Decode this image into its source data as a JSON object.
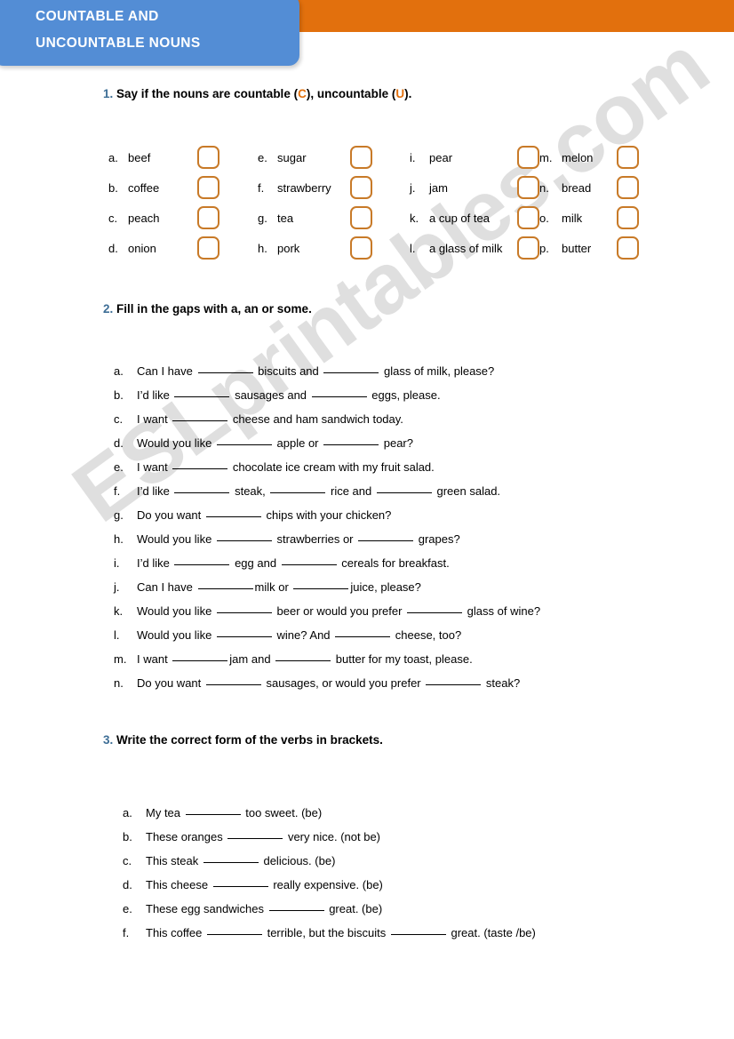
{
  "header": {
    "title_line1": "COUNTABLE AND",
    "title_line2": "UNCOUNTABLE NOUNS",
    "band_color": "#E2700D",
    "plate_color": "#538DD5"
  },
  "watermark": {
    "text": "ESLprintables.com"
  },
  "colors": {
    "heading_number": "#3E6E96",
    "accent_orange": "#E2700D",
    "checkbox_border": "#C87A28"
  },
  "exercise1": {
    "number": "1.",
    "instruction_pre": "Say if the nouns are countable (",
    "c_marker": "C",
    "instruction_mid": "), uncountable (",
    "u_marker": "U",
    "instruction_post": ").",
    "columns": [
      [
        {
          "letter": "a.",
          "word": "beef"
        },
        {
          "letter": "b.",
          "word": "coffee"
        },
        {
          "letter": "c.",
          "word": "peach"
        },
        {
          "letter": "d.",
          "word": "onion"
        }
      ],
      [
        {
          "letter": "e.",
          "word": "sugar"
        },
        {
          "letter": "f.",
          "word": "strawberry"
        },
        {
          "letter": "g.",
          "word": "tea"
        },
        {
          "letter": "h.",
          "word": "pork"
        }
      ],
      [
        {
          "letter": "i.",
          "word": "pear"
        },
        {
          "letter": "j.",
          "word": "jam"
        },
        {
          "letter": "k.",
          "word": "a cup of tea"
        },
        {
          "letter": "l.",
          "word": "a glass of milk"
        }
      ],
      [
        {
          "letter": "m.",
          "word": "melon"
        },
        {
          "letter": "n.",
          "word": "bread"
        },
        {
          "letter": "o.",
          "word": "milk"
        },
        {
          "letter": "p.",
          "word": "butter"
        }
      ]
    ]
  },
  "exercise2": {
    "number": "2.",
    "instruction": "Fill in the gaps with a, an or some.",
    "items": [
      {
        "letter": "a.",
        "parts": [
          "Can I have ",
          " biscuits and ",
          " glass of milk, please?"
        ]
      },
      {
        "letter": "b.",
        "parts": [
          "I’d like ",
          " sausages and ",
          " eggs, please."
        ]
      },
      {
        "letter": "c.",
        "parts": [
          "I want ",
          " cheese and ham sandwich today."
        ]
      },
      {
        "letter": "d.",
        "parts": [
          "Would you like ",
          " apple or ",
          " pear?"
        ]
      },
      {
        "letter": "e.",
        "parts": [
          "I want ",
          " chocolate ice cream with my fruit salad."
        ]
      },
      {
        "letter": "f.",
        "parts": [
          "I’d like ",
          " steak, ",
          " rice and ",
          " green salad."
        ]
      },
      {
        "letter": "g.",
        "parts": [
          "Do you want ",
          " chips with your chicken?"
        ]
      },
      {
        "letter": "h.",
        "parts": [
          "Would you like ",
          " strawberries or ",
          " grapes?"
        ]
      },
      {
        "letter": "i.",
        "parts": [
          "I’d like ",
          " egg and ",
          " cereals for breakfast."
        ]
      },
      {
        "letter": "j.",
        "parts": [
          "Can I have ",
          "milk or ",
          "juice, please?"
        ]
      },
      {
        "letter": "k.",
        "parts": [
          "Would you like ",
          " beer or would you prefer ",
          " glass of wine?"
        ]
      },
      {
        "letter": "l.",
        "parts": [
          "Would you like ",
          " wine? And ",
          " cheese, too?"
        ]
      },
      {
        "letter": "m.",
        "parts": [
          "I want ",
          "jam and ",
          " butter for my toast, please."
        ]
      },
      {
        "letter": "n.",
        "parts": [
          "Do you want ",
          " sausages, or would you prefer ",
          " steak?"
        ]
      }
    ]
  },
  "exercise3": {
    "number": "3.",
    "instruction": "Write the correct form of the verbs in brackets.",
    "items": [
      {
        "letter": "a.",
        "parts": [
          "My tea ",
          " too sweet. (be)"
        ]
      },
      {
        "letter": "b.",
        "parts": [
          "These oranges ",
          " very nice. (not be)"
        ]
      },
      {
        "letter": "c.",
        "parts": [
          "This steak ",
          " delicious. (be)"
        ]
      },
      {
        "letter": "d.",
        "parts": [
          "This cheese ",
          " really expensive. (be)"
        ]
      },
      {
        "letter": "e.",
        "parts": [
          "These egg sandwiches ",
          " great. (be)"
        ]
      },
      {
        "letter": "f.",
        "parts": [
          "This coffee ",
          " terrible, but the biscuits ",
          " great. (taste /be)"
        ]
      }
    ]
  }
}
